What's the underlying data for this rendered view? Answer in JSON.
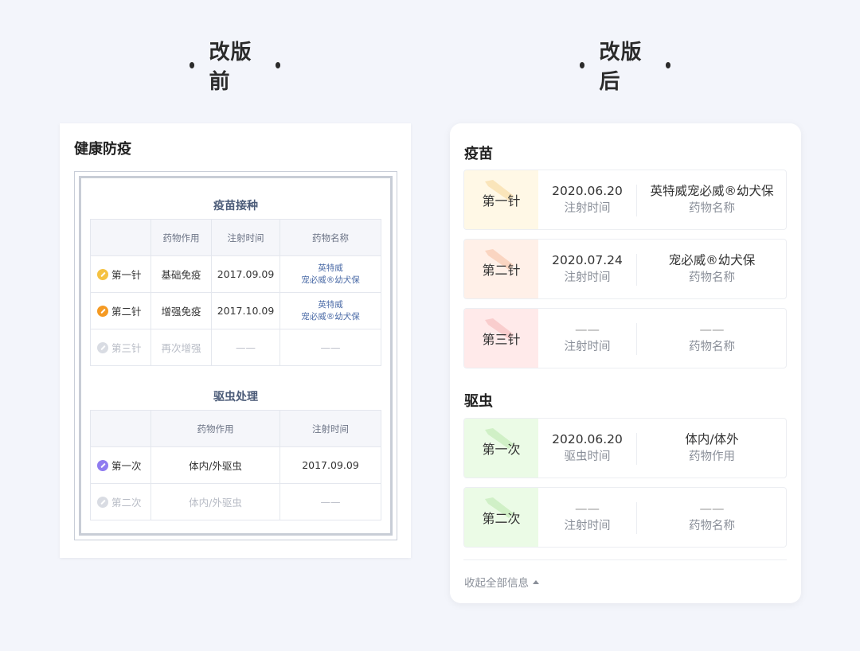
{
  "headings": {
    "before": "改版前",
    "after": "改版后"
  },
  "old": {
    "title": "健康防疫",
    "vaccine": {
      "title": "疫苗接种",
      "headers": [
        "",
        "药物作用",
        "注射时间",
        "药物名称"
      ],
      "rows": [
        {
          "dose": "第一针",
          "effect": "基础免疫",
          "time": "2017.09.09",
          "med1": "英特威",
          "med2": "宠必威®幼犬保",
          "icon_color": "#f5c242",
          "muted": false
        },
        {
          "dose": "第二针",
          "effect": "增强免疫",
          "time": "2017.10.09",
          "med1": "英特威",
          "med2": "宠必威®幼犬保",
          "icon_color": "#f59a23",
          "muted": false
        },
        {
          "dose": "第三针",
          "effect": "再次增强",
          "time": "——",
          "med1": "——",
          "med2": "",
          "icon_color": "#d9dce3",
          "muted": true
        }
      ]
    },
    "deworm": {
      "title": "驱虫处理",
      "headers": [
        "",
        "药物作用",
        "注射时间"
      ],
      "rows": [
        {
          "dose": "第一次",
          "effect": "体内/外驱虫",
          "time": "2017.09.09",
          "icon_color": "#8f7cf0",
          "muted": false
        },
        {
          "dose": "第二次",
          "effect": "体内/外驱虫",
          "time": "——",
          "icon_color": "#d9dce3",
          "muted": true
        }
      ]
    }
  },
  "new": {
    "vaccine_title": "疫苗",
    "deworm_title": "驱虫",
    "vaccine_cards": [
      {
        "badge": "第一针",
        "bg": "#fff8e6",
        "wm_color": "#f2c26b",
        "v1": "2020.06.20",
        "l1": "注射时间",
        "v2": "英特威宠必威®幼犬保",
        "l2": "药物名称"
      },
      {
        "badge": "第二针",
        "bg": "#fff0e8",
        "wm_color": "#f3a47a",
        "v1": "2020.07.24",
        "l1": "注射时间",
        "v2": "宠必威®幼犬保",
        "l2": "药物名称"
      },
      {
        "badge": "第三针",
        "bg": "#ffeaea",
        "wm_color": "#f09a9a",
        "v1": "——",
        "l1": "注射时间",
        "v2": "——",
        "l2": "药物名称"
      }
    ],
    "deworm_cards": [
      {
        "badge": "第一次",
        "bg": "#ebfbe6",
        "wm_color": "#9fdc8c",
        "v1": "2020.06.20",
        "l1": "驱虫时间",
        "v2": "体内/体外",
        "l2": "药物作用"
      },
      {
        "badge": "第二次",
        "bg": "#ebfbe6",
        "wm_color": "#9fdc8c",
        "v1": "——",
        "l1": "注射时间",
        "v2": "——",
        "l2": "药物名称"
      }
    ],
    "collapse_label": "收起全部信息"
  }
}
